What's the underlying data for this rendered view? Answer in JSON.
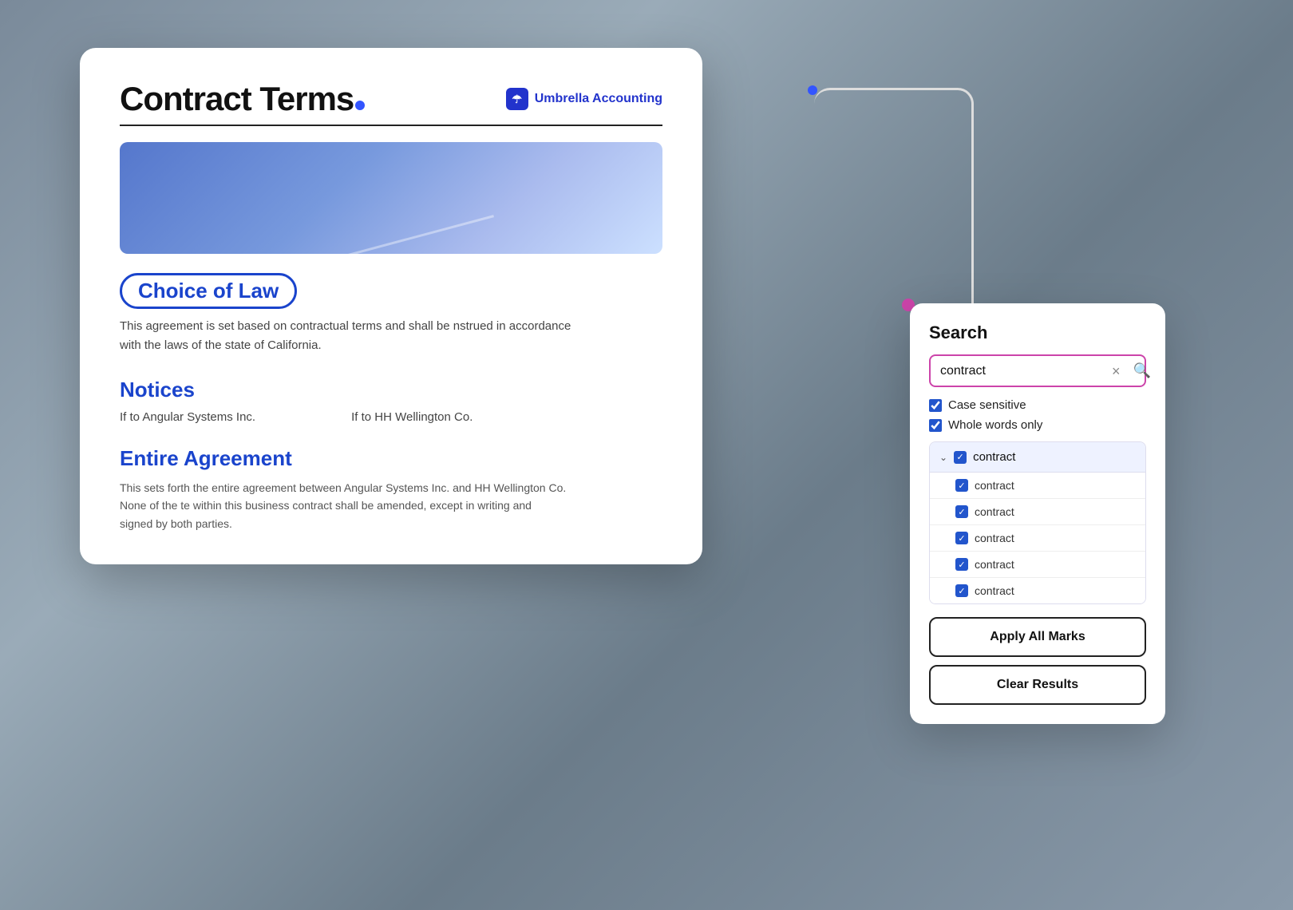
{
  "background": {
    "color": "#9aaabb"
  },
  "contract_card": {
    "title": "Contract Terms",
    "logo_text": "Umbrella Accounting",
    "sections": [
      {
        "id": "choice_of_law",
        "heading": "Choice of Law",
        "circled": true,
        "body": "This agreement is set based on contractual terms and shall be nstrued in accordance with the laws of the state of California."
      },
      {
        "id": "notices",
        "heading": "Notices",
        "circled": false,
        "col1": "If to Angular Systems Inc.",
        "col2": "If to HH Wellington Co."
      },
      {
        "id": "entire_agreement",
        "heading": "Entire Agreement",
        "circled": false,
        "body": "This sets forth the entire agreement between Angular Systems Inc. and HH Wellington Co. None of the te within this business contract shall be amended, except in writing and signed by both parties."
      }
    ]
  },
  "search_panel": {
    "title": "Search",
    "input_value": "contract",
    "input_placeholder": "Search...",
    "clear_label": "×",
    "search_icon": "🔍",
    "options": [
      {
        "id": "case_sensitive",
        "label": "Case sensitive",
        "checked": true
      },
      {
        "id": "whole_words",
        "label": "Whole words only",
        "checked": true
      }
    ],
    "results": {
      "parent": {
        "label": "contract",
        "checked": true,
        "expanded": true
      },
      "children": [
        {
          "label": "contract",
          "checked": true
        },
        {
          "label": "contract",
          "checked": true
        },
        {
          "label": "contract",
          "checked": true
        },
        {
          "label": "contract",
          "checked": true
        },
        {
          "label": "contract",
          "checked": true
        }
      ]
    },
    "buttons": [
      {
        "id": "apply_all",
        "label": "Apply All Marks"
      },
      {
        "id": "clear_results",
        "label": "Clear Results"
      }
    ]
  }
}
